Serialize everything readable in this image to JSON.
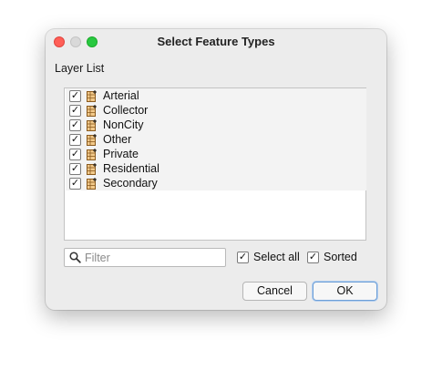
{
  "window": {
    "title": "Select Feature Types",
    "controls": [
      "close",
      "minimize",
      "zoom"
    ]
  },
  "layer_list": {
    "label": "Layer List",
    "items": [
      {
        "label": "Arterial",
        "checked": true,
        "icon": "layer-icon"
      },
      {
        "label": "Collector",
        "checked": true,
        "icon": "layer-icon"
      },
      {
        "label": "NonCity",
        "checked": true,
        "icon": "layer-icon"
      },
      {
        "label": "Other",
        "checked": true,
        "icon": "layer-icon"
      },
      {
        "label": "Private",
        "checked": true,
        "icon": "layer-icon"
      },
      {
        "label": "Residential",
        "checked": true,
        "icon": "layer-icon"
      },
      {
        "label": "Secondary",
        "checked": true,
        "icon": "layer-icon"
      }
    ]
  },
  "filter": {
    "placeholder": "Filter",
    "value": "",
    "icon": "search-icon"
  },
  "options": {
    "select_all": {
      "label": "Select all",
      "checked": true
    },
    "sorted": {
      "label": "Sorted",
      "checked": true
    }
  },
  "buttons": {
    "cancel": "Cancel",
    "ok": "OK"
  },
  "colors": {
    "close": "#ff5f57",
    "minimize": "#d9d9d9",
    "zoom": "#28c840",
    "default_button_border": "#6e9fd6"
  }
}
